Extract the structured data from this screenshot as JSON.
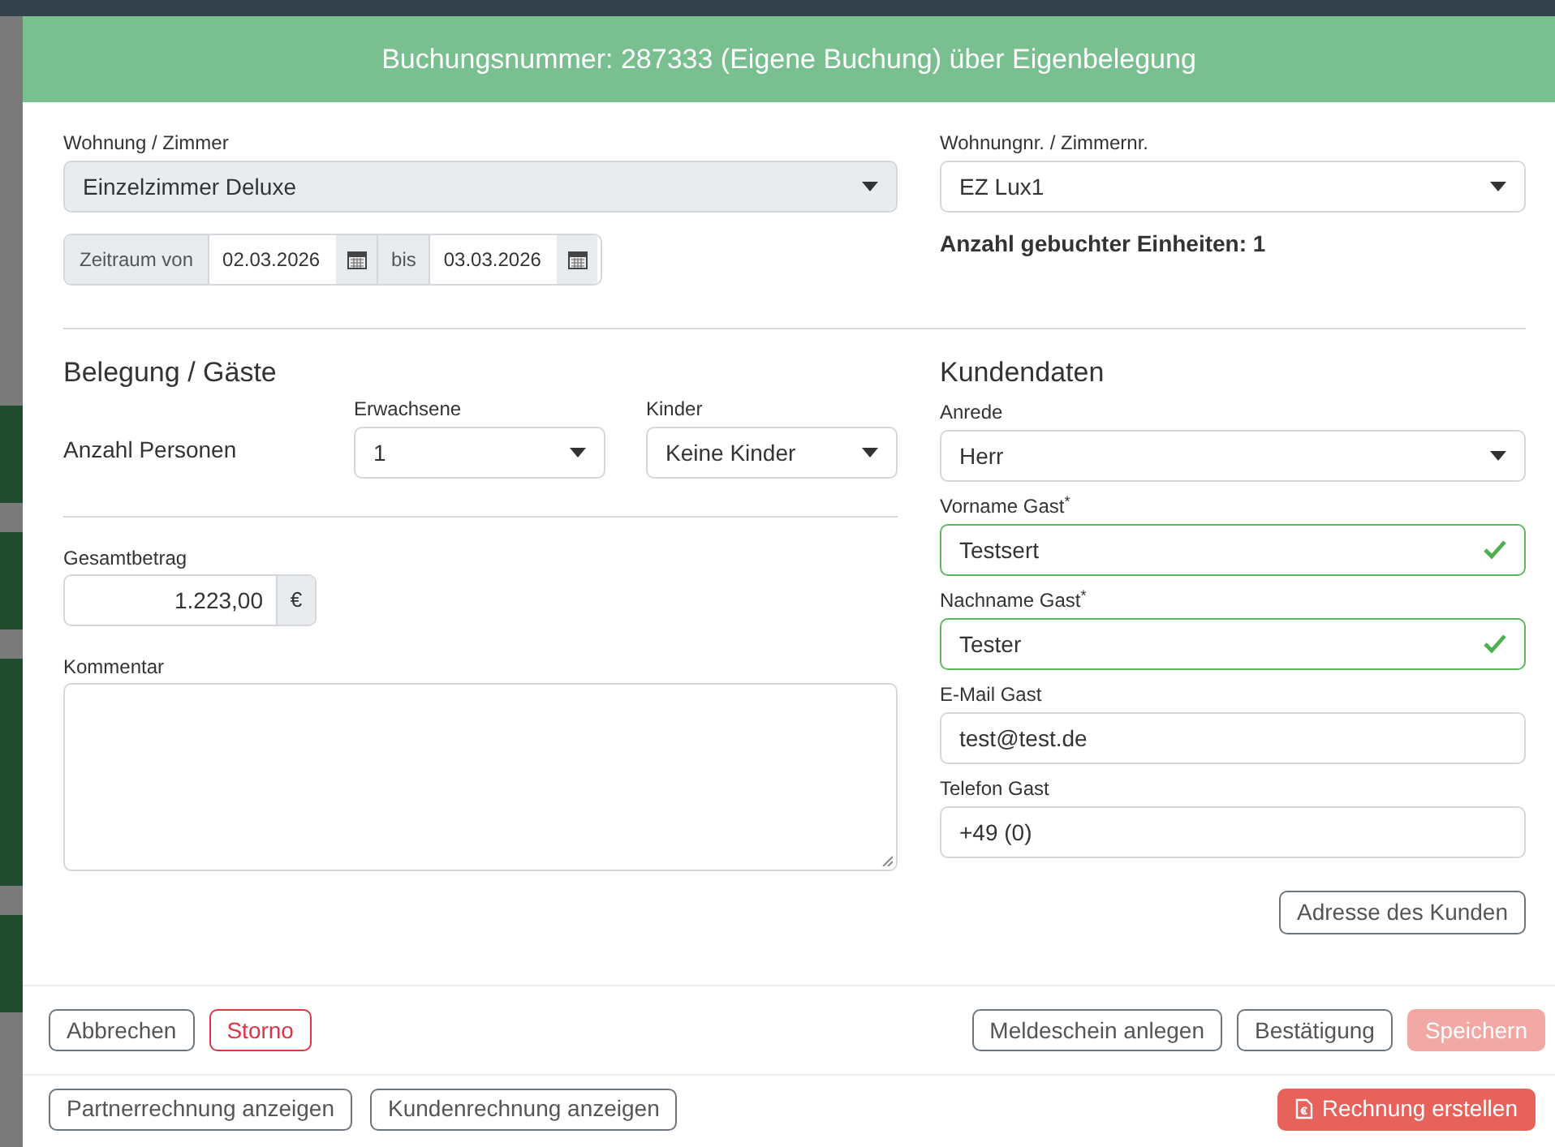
{
  "header": {
    "title": "Buchungsnummer: 287333 (Eigene Buchung) über Eigenbelegung"
  },
  "room": {
    "label": "Wohnung / Zimmer",
    "value": "Einzelzimmer Deluxe"
  },
  "period": {
    "label": "Zeitraum von",
    "from": "02.03.2026",
    "between": "bis",
    "to": "03.03.2026"
  },
  "unit": {
    "label": "Wohnungnr. / Zimmernr.",
    "value": "EZ Lux1"
  },
  "booked_units": "Anzahl gebuchter Einheiten: 1",
  "occupancy": {
    "heading": "Belegung / Gäste",
    "label": "Anzahl Personen",
    "selects": [
      {
        "label": "Erwachsene",
        "value": "1"
      },
      {
        "label": "Kinder",
        "value": "Keine Kinder"
      }
    ]
  },
  "total": {
    "label": "Gesamtbetrag",
    "value": "1.223,00",
    "unit": "€"
  },
  "comment": {
    "label": "Kommentar"
  },
  "customer": {
    "heading": "Kundendaten",
    "fields": [
      {
        "kind": "select",
        "label": "Anrede",
        "value": "Herr",
        "valid": false
      },
      {
        "kind": "text",
        "label": "Vorname Gast$^{*}$",
        "value": "Testsert",
        "valid": true
      },
      {
        "kind": "text",
        "label": "Nachname Gast$^{*}$",
        "value": "Tester",
        "valid": true
      },
      {
        "kind": "text",
        "label": "E-Mail Gast",
        "value": "test@test.de",
        "valid": false
      },
      {
        "kind": "text",
        "label": "Telefon Gast",
        "value": "+49 (0)",
        "valid": false
      }
    ],
    "address_button": "Adresse des Kunden"
  },
  "footer_left": [
    {
      "label": "Abbrechen",
      "kind": "outline",
      "disabled": false
    },
    {
      "label": "Storno",
      "kind": "danger-outline",
      "disabled": false
    }
  ],
  "footer_right": [
    {
      "label": "Meldeschein anlegen",
      "kind": "outline",
      "disabled": false
    },
    {
      "label": "Bestätigung",
      "kind": "outline",
      "disabled": false
    },
    {
      "label": "Speichern",
      "kind": "danger",
      "disabled": true
    }
  ],
  "invoice_left": [
    {
      "label": "Partnerrechnung anzeigen",
      "kind": "outline",
      "disabled": false
    },
    {
      "label": "Kundenrechnung anzeigen",
      "kind": "outline",
      "disabled": false
    }
  ],
  "invoice_right": [
    {
      "label": "Rechnung erstellen",
      "kind": "danger",
      "disabled": false
    }
  ]
}
